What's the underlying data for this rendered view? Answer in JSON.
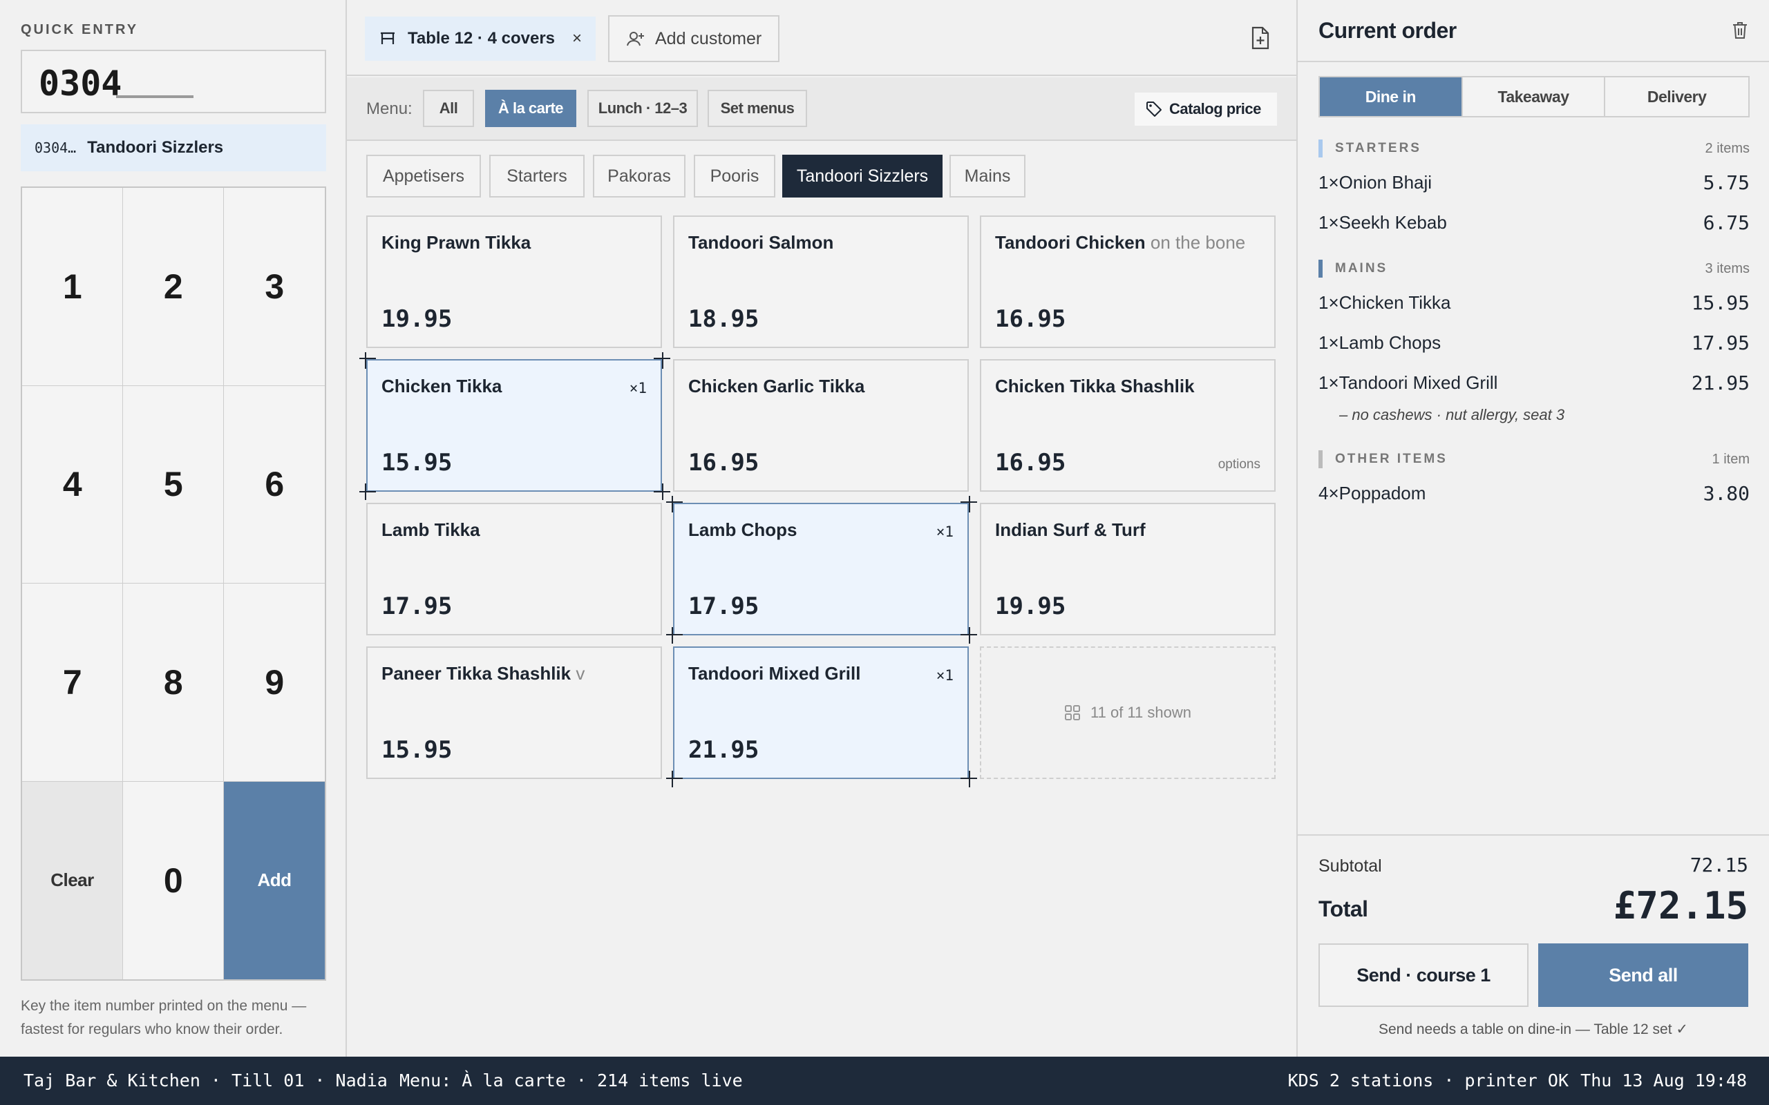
{
  "quick_entry": {
    "label": "QUICK ENTRY",
    "value": "0304",
    "match_code": "0304…",
    "match_name": "Tandoori Sizzlers",
    "keys": [
      "1",
      "2",
      "3",
      "4",
      "5",
      "6",
      "7",
      "8",
      "9",
      "Clear",
      "0",
      "Add"
    ],
    "help": "Key the item number printed on the menu — fastest for regulars who know their order."
  },
  "header": {
    "table_chip": "Table 12 · 4 covers",
    "close_glyph": "×",
    "add_customer": "Add customer"
  },
  "menu_bar": {
    "label": "Menu:",
    "menus": [
      "All",
      "À la carte",
      "Lunch · 12–3",
      "Set menus"
    ],
    "active_menu": "À la carte",
    "catalog_price": "Catalog price"
  },
  "categories": {
    "items": [
      "Appetisers",
      "Starters",
      "Pakoras",
      "Pooris",
      "Tandoori Sizzlers",
      "Mains"
    ],
    "active": "Tandoori Sizzlers"
  },
  "items": [
    {
      "name": "King Prawn Tikka",
      "note": "",
      "price": "19.95",
      "qty": "",
      "options": ""
    },
    {
      "name": "Tandoori Salmon",
      "note": "",
      "price": "18.95",
      "qty": "",
      "options": ""
    },
    {
      "name": "Tandoori Chicken",
      "note": "on the bone",
      "price": "16.95",
      "qty": "",
      "options": ""
    },
    {
      "name": "Chicken Tikka",
      "note": "",
      "price": "15.95",
      "qty": "×1",
      "options": ""
    },
    {
      "name": "Chicken Garlic Tikka",
      "note": "",
      "price": "16.95",
      "qty": "",
      "options": ""
    },
    {
      "name": "Chicken Tikka Shashlik",
      "note": "",
      "price": "16.95",
      "qty": "",
      "options": "options"
    },
    {
      "name": "Lamb Tikka",
      "note": "",
      "price": "17.95",
      "qty": "",
      "options": ""
    },
    {
      "name": "Lamb Chops",
      "note": "",
      "price": "17.95",
      "qty": "×1",
      "options": ""
    },
    {
      "name": "Indian Surf & Turf",
      "note": "",
      "price": "19.95",
      "qty": "",
      "options": ""
    },
    {
      "name": "Paneer Tikka Shashlik",
      "note": "v",
      "price": "15.95",
      "qty": "",
      "options": ""
    },
    {
      "name": "Tandoori Mixed Grill",
      "note": "",
      "price": "21.95",
      "qty": "×1",
      "options": ""
    }
  ],
  "items_shown": "11 of 11 shown",
  "order": {
    "title": "Current order",
    "service_modes": [
      "Dine in",
      "Takeaway",
      "Delivery"
    ],
    "active_mode": "Dine in",
    "courses": [
      {
        "title": "STARTERS",
        "count": "2 items",
        "color": "#a9c9ee",
        "lines": [
          {
            "qty": "1×",
            "name": "Onion Bhaji",
            "price": "5.75"
          },
          {
            "qty": "1×",
            "name": "Seekh Kebab",
            "price": "6.75"
          }
        ]
      },
      {
        "title": "MAINS",
        "count": "3 items",
        "color": "#5b80a8",
        "lines": [
          {
            "qty": "1×",
            "name": "Chicken Tikka",
            "price": "15.95"
          },
          {
            "qty": "1×",
            "name": "Lamb Chops",
            "price": "17.95"
          },
          {
            "qty": "1×",
            "name": "Tandoori Mixed Grill",
            "price": "21.95",
            "modifier": "– no cashews · nut allergy, seat 3"
          }
        ]
      },
      {
        "title": "OTHER ITEMS",
        "count": "1 item",
        "color": "#bbbbbb",
        "lines": [
          {
            "qty": "4×",
            "name": "Poppadom",
            "price": "3.80"
          }
        ]
      }
    ],
    "subtotal_label": "Subtotal",
    "subtotal": "72.15",
    "total_label": "Total",
    "total": "£72.15",
    "send_course": "Send · course 1",
    "send_all": "Send all",
    "send_note": "Send needs a table on dine-in — Table 12 set ✓"
  },
  "status_bar": {
    "left": "Taj Bar & Kitchen · Till 01 · Nadia",
    "menu": "Menu: À la carte · 214 items live",
    "kds": "KDS 2 stations · printer OK",
    "time": "Thu 13 Aug 19:48"
  },
  "colors": {
    "accent": "#5b80a8",
    "dark": "#1e2a3a",
    "selected_bg": "#edf4fd"
  }
}
